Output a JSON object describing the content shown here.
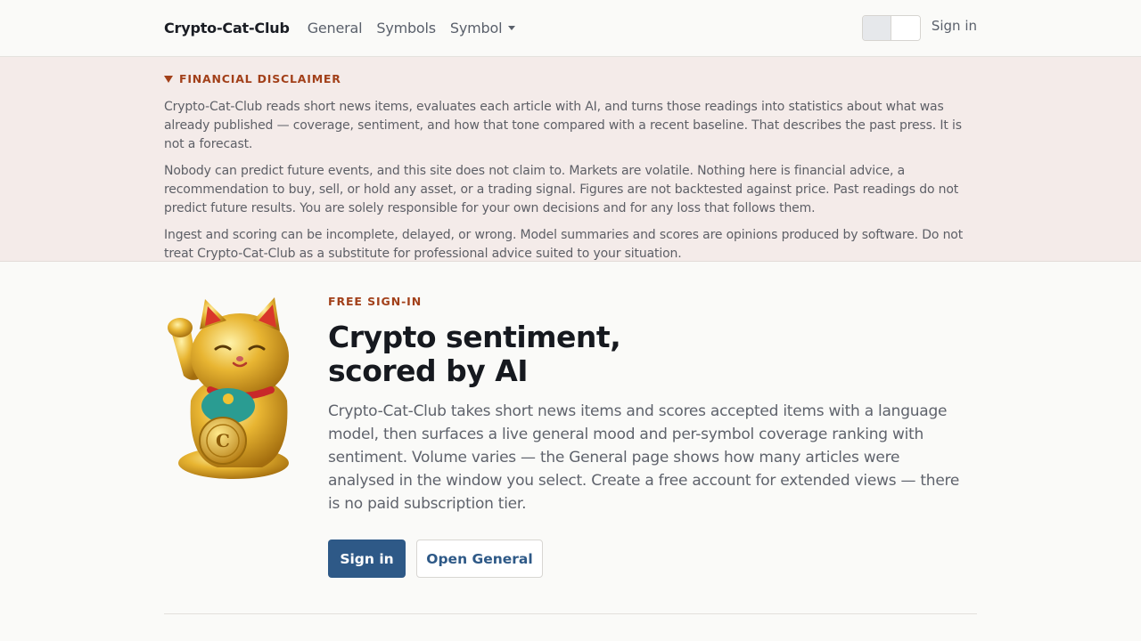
{
  "nav": {
    "brand": "Crypto-Cat-Club",
    "links": [
      "General",
      "Symbols",
      "Symbol"
    ],
    "sign_in": "Sign in"
  },
  "disclaimer": {
    "title": "FINANCIAL DISCLAIMER",
    "paragraphs": [
      "Crypto-Cat-Club reads short news items, evaluates each article with AI, and turns those readings into statistics about what was already published — coverage, sentiment, and how that tone compared with a recent baseline. That describes the past press. It is not a forecast.",
      "Nobody can predict future events, and this site does not claim to. Markets are volatile. Nothing here is financial advice, a recommendation to buy, sell, or hold any asset, or a trading signal. Figures are not backtested against price. Past readings do not predict future results. You are solely responsible for your own decisions and for any loss that follows them.",
      "Ingest and scoring can be incomplete, delayed, or wrong. Model summaries and scores are opinions produced by software. Do not treat Crypto-Cat-Club as a substitute for professional advice suited to your situation."
    ]
  },
  "hero": {
    "eyebrow": "FREE SIGN-IN",
    "title_line1": "Crypto sentiment,",
    "title_line2": "scored by AI",
    "body": "Crypto-Cat-Club takes short news items and scores accepted items with a language model, then surfaces a live general mood and per-symbol coverage ranking with sentiment. Volume varies — the General page shows how many articles were analysed in the window you select. Create a free account for extended views — there is no paid subscription tier.",
    "primary_button": "Sign in",
    "secondary_button": "Open General",
    "image_icon": "lucky-cat-icon"
  },
  "colors": {
    "accent": "#2e5987",
    "eyebrow": "#a2401a",
    "disclaimer_bg": "#f4ebe9"
  }
}
